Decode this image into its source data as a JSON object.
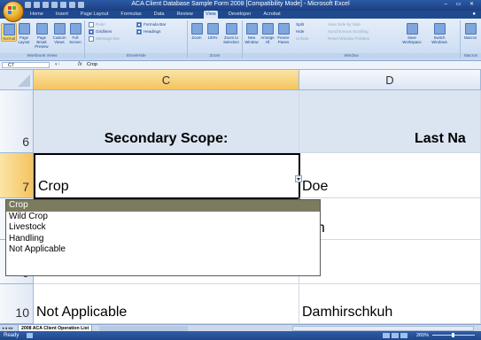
{
  "window": {
    "title": "ACA Client Database Sample Form 2008 [Compatibility Mode] - Microsoft Excel",
    "controls": "– ▭ ✕"
  },
  "ribbon": {
    "tabs": [
      "Home",
      "Insert",
      "Page Layout",
      "Formulas",
      "Data",
      "Review",
      "View",
      "Developer",
      "Acrobat"
    ],
    "active_tab": "View",
    "groups": {
      "workbook_views": {
        "label": "Workbook Views",
        "buttons": [
          "Normal",
          "Page Layout",
          "Page Break Preview",
          "Custom Views",
          "Full Screen"
        ]
      },
      "show_hide": {
        "label": "Show/Hide",
        "items": [
          {
            "label": "Ruler",
            "checked": false,
            "enabled": false
          },
          {
            "label": "Gridlines",
            "checked": true,
            "enabled": true
          },
          {
            "label": "Message Bar",
            "checked": false,
            "enabled": false
          },
          {
            "label": "Formula Bar",
            "checked": true,
            "enabled": true
          },
          {
            "label": "Headings",
            "checked": true,
            "enabled": true
          }
        ]
      },
      "zoom": {
        "label": "Zoom",
        "buttons": [
          "Zoom",
          "100%",
          "Zoom to Selection"
        ]
      },
      "window": {
        "label": "Window",
        "buttons": [
          "New Window",
          "Arrange All",
          "Freeze Panes"
        ],
        "small": [
          "Split",
          "Hide",
          "Unhide",
          "View Side by Side",
          "Synchronous Scrolling",
          "Reset Window Position"
        ],
        "save_workspace": "Save Workspace",
        "switch_windows": "Switch Windows"
      },
      "macros": {
        "label": "Macros",
        "button": "Macros"
      }
    }
  },
  "formula_bar": {
    "cell_ref": "C7",
    "fx": "fx",
    "value": "Crop"
  },
  "sheet": {
    "columns": [
      "C",
      "D"
    ],
    "rows": [
      {
        "num": "6",
        "c": "Secondary Scope:",
        "d": "Last Na"
      },
      {
        "num": "7",
        "c": "Crop",
        "d": "Doe"
      },
      {
        "num": "8",
        "c": "",
        "d": "nith"
      },
      {
        "num": "9",
        "c": "",
        "d": "ller"
      },
      {
        "num": "10",
        "c": "Not Applicable",
        "d": "Damhirschkuh"
      }
    ]
  },
  "dropdown": {
    "options": [
      "Crop",
      "Wild Crop",
      "Livestock",
      "Handling",
      "Not Applicable"
    ],
    "selected": "Crop"
  },
  "sheet_tabs": {
    "active": "2008 ACA Client Operation List"
  },
  "status": {
    "ready": "Ready",
    "zoom": "265%"
  }
}
